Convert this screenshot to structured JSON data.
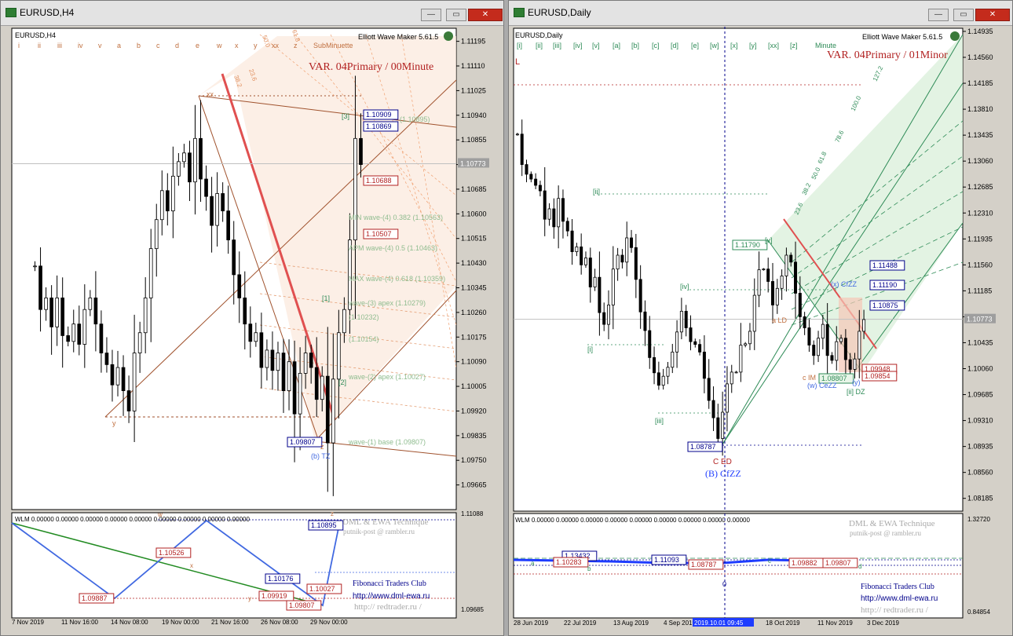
{
  "left": {
    "title": "EURUSD,H4",
    "buttons": {
      "min": "—",
      "max": "▭",
      "close": "✕"
    },
    "symbol_label": "EURUSD,H4",
    "wave_labels": [
      "i",
      "ii",
      "iii",
      "iv",
      "v",
      "a",
      "b",
      "c",
      "d",
      "e",
      "w",
      "x",
      "y",
      "xx",
      "z",
      "SubMinuette"
    ],
    "ewm": "Elliott Wave Maker 5.61.5",
    "var_title": "VAR. 04Primary / 00Minute",
    "price_ticks": [
      "1.11195",
      "1.11110",
      "1.11025",
      "1.10940",
      "1.10855",
      "1.10770",
      "1.10685",
      "1.10600",
      "1.10515",
      "1.10430",
      "1.10345",
      "1.10260",
      "1.10175",
      "1.10090",
      "1.10005",
      "1.09920",
      "1.09835",
      "1.09750",
      "1.09665"
    ],
    "current_price": "1.10773",
    "boxes": [
      "1.10909",
      "1.10869",
      "1.10688",
      "1.10507",
      "1.09807"
    ],
    "notes": {
      "b5": "(1.10895)",
      "min4": "MIN wave-(4) 0.382 (1.10563)",
      "apm": "APM wave-(4) 0.5 (1.10463)",
      "max4": "MAX wave-(4) 0.618 (1.10359)",
      "apex3": "wave-(3) apex (1.10279)",
      "p232": "(1.10232)",
      "p154": "(1.10154)",
      "apex2": "wave-(2) apex (1.10027)",
      "base1": "wave-(1) base (1.09807)"
    },
    "pts": {
      "xx": "xx",
      "y": "y",
      "z": "z",
      "tz": "(b) TZ",
      "w1": "[1]",
      "w2": "[2]",
      "w3": "[3]",
      "fib1": "23.6",
      "fib2": "38.2",
      "fib3": "50.0",
      "fib4": "61.8"
    },
    "ind_label": "WLM 0.00000 0.00000 0.00000 0.00000 0.00000 0.00000 0.00000 0.00000 0.00000",
    "ind_ticks": [
      "1.11088",
      "1.09685"
    ],
    "ind_boxes": [
      "1.10526",
      "1.10176",
      "1.10027",
      "1.09887",
      "1.09919",
      "1.09807",
      "1.10895"
    ],
    "ind_letters": [
      "w",
      "x",
      "y",
      "z"
    ],
    "credit": {
      "dml": "DML & EWA Technique",
      "email": "putnik-post @ rambler.ru",
      "fib": "Fibonacci    Traders    Club",
      "site": "http://www.dml-ewa.ru",
      "trader": "http:// redtrader.ru /"
    },
    "dates": [
      "7 Nov 2019",
      "11 Nov 16:00",
      "14 Nov 08:00",
      "19 Nov 00:00",
      "21 Nov 16:00",
      "26 Nov 08:00",
      "29 Nov 00:00"
    ]
  },
  "right": {
    "title": "EURUSD,Daily",
    "buttons": {
      "min": "—",
      "max": "▭",
      "close": "✕"
    },
    "symbol_label": "EURUSD,Daily",
    "wave_labels": [
      "[i]",
      "[ii]",
      "[iii]",
      "[iv]",
      "[v]",
      "[a]",
      "[b]",
      "[c]",
      "[d]",
      "[e]",
      "[w]",
      "[x]",
      "[y]",
      "[xx]",
      "[z]",
      "Minute"
    ],
    "ewm": "Elliott Wave Maker 5.61.5",
    "var_title": "VAR. 04Primary / 01Minor",
    "L": "L",
    "price_ticks": [
      "1.14935",
      "1.14560",
      "1.14185",
      "1.13810",
      "1.13435",
      "1.13060",
      "1.12685",
      "1.12310",
      "1.11935",
      "1.11560",
      "1.11185",
      "1.10810",
      "1.10435",
      "1.10060",
      "1.09685",
      "1.09310",
      "1.08935",
      "1.08560",
      "1.08185"
    ],
    "current_price": "1.10773",
    "boxes": [
      "1.11790",
      "1.11488",
      "1.11190",
      "1.10875",
      "1.09948",
      "1.09854",
      "1.08787",
      "1.08807"
    ],
    "pts": {
      "i": "[i]",
      "ii": "[ii]",
      "iii": "[iii]",
      "iv": "[iv]",
      "v": "[v]",
      "ii2": "[ii] DZ",
      "ced": "C ED",
      "bcfzz": "(B) CfZZ",
      "ld": "a LD",
      "cim": "c IM",
      "wcezz": "(w) CeZZ",
      "y": "(y)",
      "xcf": "(x) CfZZ",
      "f236": "23.6",
      "f382": "38.2",
      "f50": "50.0",
      "f618": "61.8",
      "f786": "78.6",
      "f100": "100.0",
      "f1272": "127.2"
    },
    "ind_label": "WLM 0.00000 0.00000 0.00000 0.00000 0.00000 0.00000 0.00000 0.00000 0.00000",
    "ind_ticks": [
      "1.32720",
      "0.84854"
    ],
    "ind_boxes": [
      "1.13432",
      "1.10283",
      "1.11093",
      "1.08787",
      "1.09882",
      "1.09807"
    ],
    "ind_letters": [
      "a",
      "b",
      "c",
      "d"
    ],
    "ind_zero": "0",
    "credit": {
      "dml": "DML & EWA Technique",
      "email": "putnik-post @ rambler.ru",
      "fib": "Fibonacci    Traders    Club",
      "site": "http://www.dml-ewa.ru",
      "trader": "http:// redtrader.ru /"
    },
    "dates": [
      "28 Jun 2019",
      "22 Jul 2019",
      "13 Aug 2019",
      "4 Sep 2019",
      "2019.10.01 09:45",
      "18 Oct 2019",
      "11 Nov 2019",
      "3 Dec 2019"
    ]
  },
  "chart_data": [
    {
      "type": "candlestick",
      "title": "EURUSD,H4",
      "ylim": [
        1.0958,
        1.1124
      ],
      "y_ticks": [
        1.11195,
        1.1111,
        1.11025,
        1.1094,
        1.10855,
        1.1077,
        1.10685,
        1.106,
        1.10515,
        1.1043,
        1.10345,
        1.1026,
        1.10175,
        1.1009,
        1.10005,
        1.0992,
        1.09835,
        1.0975,
        1.09665
      ],
      "x_ticks": [
        "7 Nov 2019",
        "11 Nov 16:00",
        "14 Nov 08:00",
        "19 Nov 00:00",
        "21 Nov 16:00",
        "26 Nov 08:00",
        "29 Nov 00:00"
      ],
      "close_path": [
        1.1042,
        1.1027,
        1.1031,
        1.1021,
        1.1031,
        1.1018,
        1.1016,
        1.1022,
        1.1015,
        1.1027,
        1.1031,
        1.1022,
        1.1012,
        1.1008,
        1.1001,
        1.1007,
        1.0999,
        1.0992,
        1.1012,
        1.1019,
        1.1031,
        1.1048,
        1.1058,
        1.1068,
        1.1061,
        1.1073,
        1.1078,
        1.1081,
        1.1071,
        1.1086,
        1.1072,
        1.1066,
        1.1056,
        1.1067,
        1.1061,
        1.1051,
        1.1039,
        1.1031,
        1.1022,
        1.1016,
        1.1019,
        1.1007,
        1.1013,
        1.1006,
        1.1012,
        1.0999,
        1.1009,
        1.0991,
        1.1005,
        1.1012,
        1.1007,
        1.0996,
        1.1004,
        1.0981,
        1.1003,
        1.1019,
        1.1027,
        1.1051,
        1.1086,
        1.1077
      ],
      "last_price": 1.10773
    },
    {
      "type": "candlestick",
      "title": "EURUSD,Daily",
      "ylim": [
        1.08,
        1.1498
      ],
      "y_ticks": [
        1.14935,
        1.1456,
        1.14185,
        1.1381,
        1.13435,
        1.1306,
        1.12685,
        1.1231,
        1.11935,
        1.1156,
        1.11185,
        1.1081,
        1.10435,
        1.1006,
        1.09685,
        1.0931,
        1.08935,
        1.0856,
        1.08185
      ],
      "x_ticks": [
        "28 Jun 2019",
        "22 Jul 2019",
        "13 Aug 2019",
        "4 Sep 2019",
        "2019.10.01 09:45",
        "18 Oct 2019",
        "11 Nov 2019",
        "3 Dec 2019"
      ],
      "close_path": [
        1.1345,
        1.1301,
        1.1287,
        1.128,
        1.1271,
        1.1263,
        1.1222,
        1.1237,
        1.1211,
        1.1252,
        1.1219,
        1.1205,
        1.1175,
        1.1182,
        1.1156,
        1.1166,
        1.1124,
        1.1138,
        1.1087,
        1.107,
        1.1098,
        1.115,
        1.117,
        1.116,
        1.1195,
        1.1181,
        1.1135,
        1.1088,
        1.1061,
        1.1022,
        1.1,
        1.0982,
        1.0995,
        1.1008,
        1.103,
        1.1059,
        1.1089,
        1.1065,
        1.1045,
        1.1041,
        1.103,
        1.0992,
        1.096,
        1.0935,
        1.0905,
        1.0943,
        1.0984,
        1.1001,
        1.1001,
        1.104,
        1.1042,
        1.106,
        1.1112,
        1.1149,
        1.115,
        1.1132,
        1.1098,
        1.1122,
        1.114,
        1.117,
        1.116,
        1.1115,
        1.1081,
        1.1065,
        1.104,
        1.1025,
        1.105,
        1.107,
        1.1025,
        1.1018,
        1.1045,
        1.105,
        1.1019,
        1.1005,
        1.102,
        1.106,
        1.1077
      ],
      "last_price": 1.10773
    }
  ]
}
